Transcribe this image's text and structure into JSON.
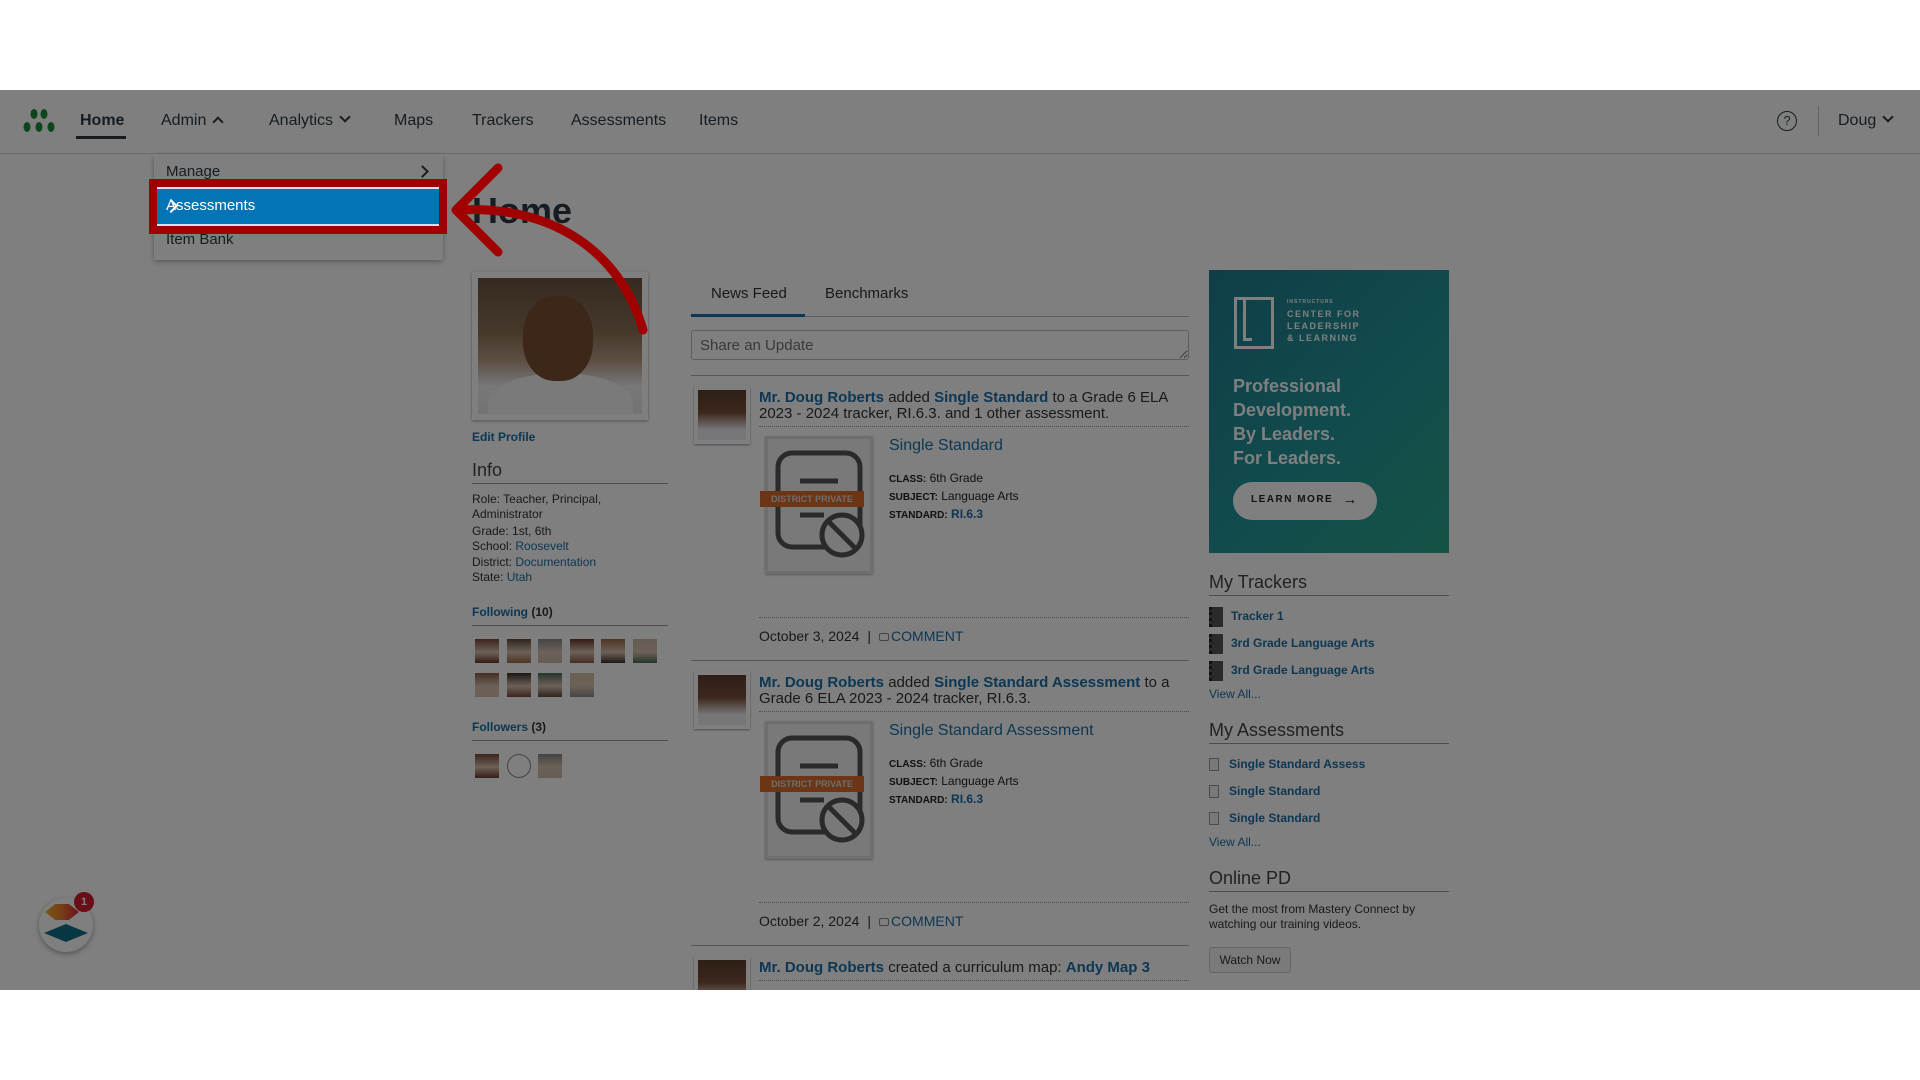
{
  "nav": {
    "items": [
      {
        "label": "Home",
        "active": true
      },
      {
        "label": "Admin",
        "chevron": "up"
      },
      {
        "label": "Analytics",
        "chevron": "down"
      },
      {
        "label": "Maps"
      },
      {
        "label": "Trackers"
      },
      {
        "label": "Assessments"
      },
      {
        "label": "Items"
      }
    ],
    "help_icon": "question-circle-icon",
    "user": "Doug"
  },
  "admin_menu": {
    "items": [
      {
        "label": "Manage",
        "has_submenu": true
      },
      {
        "label": "Assessments",
        "has_submenu": true,
        "highlighted": true
      },
      {
        "label": "Item Bank",
        "has_submenu": false
      }
    ]
  },
  "page": {
    "title": "Home"
  },
  "profile": {
    "edit_label": "Edit Profile",
    "info_heading": "Info",
    "role_label": "Role:",
    "role": "Teacher, Principal,",
    "role2": "Administrator",
    "grade_label": "Grade:",
    "grade": "1st, 6th",
    "school_label": "School:",
    "school": "Roosevelt",
    "district_label": "District:",
    "district": "Documentation",
    "state_label": "State:",
    "state": "Utah",
    "following_label": "Following",
    "following_count": "(10)",
    "followers_label": "Followers",
    "followers_count": "(3)"
  },
  "feed": {
    "tabs": [
      {
        "label": "News Feed",
        "active": true
      },
      {
        "label": "Benchmarks"
      }
    ],
    "share_placeholder": "Share an Update",
    "posts": [
      {
        "author": "Mr. Doug Roberts",
        "verb": "added",
        "object": "Single Standard",
        "rest": "to a Grade 6 ELA 2023 - 2024 tracker, RI.6.3. and 1 other assessment.",
        "card_title": "Single Standard",
        "badge": "DISTRICT PRIVATE",
        "class_label": "CLASS:",
        "class": "6th Grade",
        "subject_label": "SUBJECT:",
        "subject": "Language Arts",
        "standard_label": "STANDARD:",
        "standard": "RI.6.3",
        "date": "October 3, 2024",
        "comment": "COMMENT"
      },
      {
        "author": "Mr. Doug Roberts",
        "verb": "added",
        "object": "Single Standard Assessment",
        "rest": "to a Grade 6 ELA 2023 - 2024 tracker, RI.6.3.",
        "card_title": "Single Standard Assessment",
        "badge": "DISTRICT PRIVATE",
        "class_label": "CLASS:",
        "class": "6th Grade",
        "subject_label": "SUBJECT:",
        "subject": "Language Arts",
        "standard_label": "STANDARD:",
        "standard": "RI.6.3",
        "date": "October 2, 2024",
        "comment": "COMMENT"
      },
      {
        "author": "Mr. Doug Roberts",
        "verb": "created a curriculum map:",
        "object": "Andy Map 3"
      }
    ]
  },
  "sidebar": {
    "ad": {
      "brand_small": "INSTRUCTURE",
      "brand_lines": [
        "CENTER FOR",
        "LEADERSHIP",
        "& LEARNING"
      ],
      "headline": [
        "Professional",
        "Development.",
        "By Leaders.",
        "For Leaders."
      ],
      "cta": "LEARN MORE",
      "brand_color": "#23959b"
    },
    "trackers_heading": "My Trackers",
    "trackers": [
      "Tracker 1",
      "3rd Grade Language Arts",
      "3rd Grade Language Arts"
    ],
    "trackers_view_all": "View All...",
    "assessments_heading": "My Assessments",
    "assessments": [
      "Single Standard Assess",
      "Single Standard",
      "Single Standard"
    ],
    "assessments_view_all": "View All...",
    "pd_heading": "Online PD",
    "pd_text": "Get the most from Mastery Connect by watching our training videos.",
    "pd_button": "Watch Now"
  },
  "widget": {
    "badge_count": "1"
  },
  "colors": {
    "accent": "#0374b5",
    "link": "#1b6ea7",
    "annotation": "#a00000",
    "badge": "#d86a2a"
  }
}
